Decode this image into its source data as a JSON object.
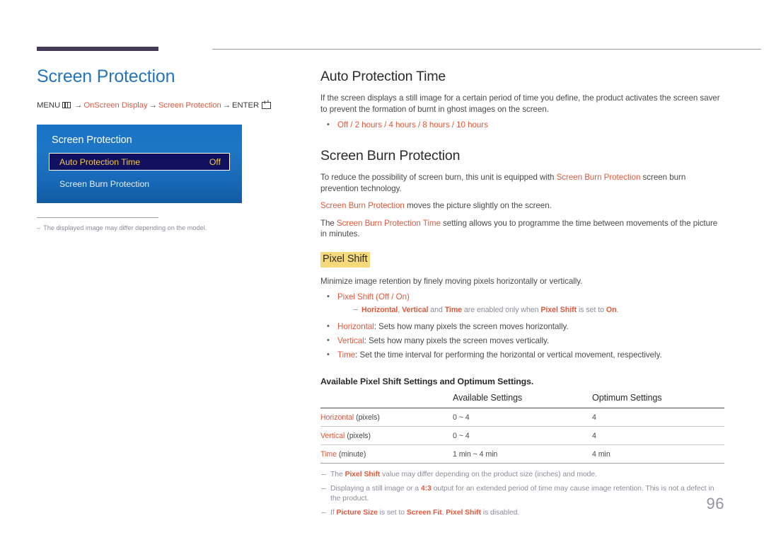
{
  "page": {
    "number": "96",
    "title": "Screen Protection"
  },
  "breadcrumb": {
    "menu_label": "MENU",
    "menu_icon": "menu-grid-icon",
    "arrow": "→",
    "item1": "OnScreen Display",
    "item2": "Screen Protection",
    "enter_label": "ENTER",
    "enter_icon": "enter-key-icon"
  },
  "osd": {
    "title": "Screen Protection",
    "rows": [
      {
        "label": "Auto Protection Time",
        "value": "Off",
        "selected": true
      },
      {
        "label": "Screen Burn Protection",
        "value": "",
        "selected": false
      }
    ]
  },
  "left_note": {
    "dash": "–",
    "text": "The displayed image may differ depending on the model."
  },
  "sections": {
    "auto_protection": {
      "heading": "Auto Protection Time",
      "paragraph": "If the screen displays a still image for a certain period of time you define, the product activates the screen saver to prevent the formation of burnt in ghost images on the screen.",
      "options": "Off / 2 hours / 4 hours / 8 hours / 10 hours"
    },
    "burn_protection": {
      "heading": "Screen Burn Protection",
      "p1_a": "To reduce the possibility of screen burn, this unit is equipped with ",
      "p1_term": "Screen Burn Protection",
      "p1_b": " screen burn prevention technology.",
      "p2_term": "Screen Burn Protection",
      "p2_b": " moves the picture slightly on the screen.",
      "p3_a": "The ",
      "p3_term": "Screen Burn Protection Time",
      "p3_b": " setting allows you to programme the time between movements of the picture in minutes."
    },
    "pixel_shift": {
      "heading": "Pixel Shift",
      "paragraph": "Minimize image retention by finely moving pixels horizontally or vertically.",
      "bullet1_term": "Pixel Shift",
      "bullet1_values": "(Off / On)",
      "subnote_t1": "Horizontal",
      "subnote_s1": ", ",
      "subnote_t2": "Vertical",
      "subnote_s2": " and ",
      "subnote_t3": "Time",
      "subnote_s3": " are enabled only when ",
      "subnote_t4": "Pixel Shift",
      "subnote_s4": " is set to ",
      "subnote_t5": "On",
      "subnote_s5": ".",
      "bullet2_term": "Horizontal",
      "bullet2_text": ": Sets how many pixels the screen moves horizontally.",
      "bullet3_term": "Vertical",
      "bullet3_text": ": Sets how many pixels the screen moves vertically.",
      "bullet4_term": "Time",
      "bullet4_text": ": Set the time interval for performing the horizontal or vertical movement, respectively."
    }
  },
  "table": {
    "caption": "Available Pixel Shift Settings and Optimum Settings.",
    "columns": [
      "",
      "Available Settings",
      "Optimum Settings"
    ],
    "rows": [
      {
        "term": "Horizontal",
        "unit": " (pixels)",
        "available": "0 ~ 4",
        "optimum": "4"
      },
      {
        "term": "Vertical",
        "unit": " (pixels)",
        "available": "0 ~ 4",
        "optimum": "4"
      },
      {
        "term": "Time",
        "unit": " (minute)",
        "available": "1 min ~ 4 min",
        "optimum": "4 min"
      }
    ]
  },
  "tail_notes": {
    "n1_a": "The ",
    "n1_t": "Pixel Shift",
    "n1_b": " value may differ depending on the product size (inches) and mode.",
    "n2_a": "Displaying a still image or a ",
    "n2_t": "4:3",
    "n2_b": " output for an extended period of time may cause image retention. This is not a defect in the product.",
    "n3_a": "If ",
    "n3_t1": "Picture Size",
    "n3_b1": " is set to ",
    "n3_t2": "Screen Fit",
    "n3_b2": ", ",
    "n3_t3": "Pixel Shift",
    "n3_b3": " is disabled."
  },
  "colors": {
    "title_blue": "#2575b8",
    "accent_orange": "#e1593c",
    "highlight_yellow": "#f6d97a",
    "rule_purple": "#443a56",
    "osd_blue": "#1972c4",
    "osd_selected": "#10105e",
    "osd_selected_text": "#f5c842",
    "note_gray": "#8d8d9b"
  }
}
